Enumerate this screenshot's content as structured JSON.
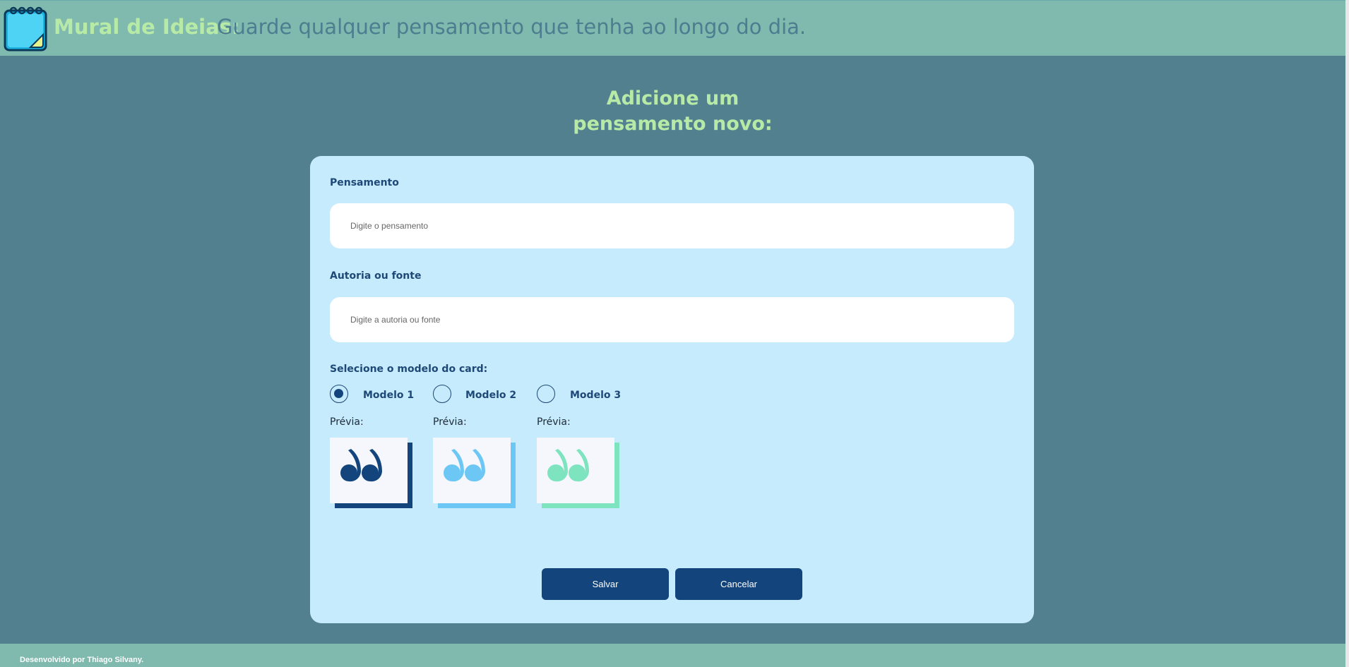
{
  "header": {
    "title": "Mural de Ideias:",
    "subtitle": "Guarde qualquer pensamento que tenha ao longo do dia.",
    "logo_icon": "notepad-icon"
  },
  "form": {
    "heading_line1": "Adicione um",
    "heading_line2": "pensamento novo:",
    "thought_label": "Pensamento",
    "thought_placeholder": "Digite o pensamento",
    "thought_value": "",
    "author_label": "Autoria ou fonte",
    "author_placeholder": "Digite a autoria ou fonte",
    "author_value": "",
    "model_label": "Selecione o modelo do card:",
    "models": [
      {
        "label": "Modelo 1",
        "preview_label": "Prévia:",
        "color": "#13447b",
        "selected": true
      },
      {
        "label": "Modelo 2",
        "preview_label": "Prévia:",
        "color": "#6cc7f4",
        "selected": false
      },
      {
        "label": "Modelo 3",
        "preview_label": "Prévia:",
        "color": "#7ee3bf",
        "selected": false
      }
    ],
    "save_label": "Salvar",
    "cancel_label": "Cancelar"
  },
  "footer": {
    "text": "Desenvolvido por Thiago Silvany."
  },
  "colors": {
    "background": "#52808f",
    "header": "#80b9ad",
    "card": "#c5ebfc",
    "accent": "#b8eaa7",
    "button": "#13447b"
  }
}
